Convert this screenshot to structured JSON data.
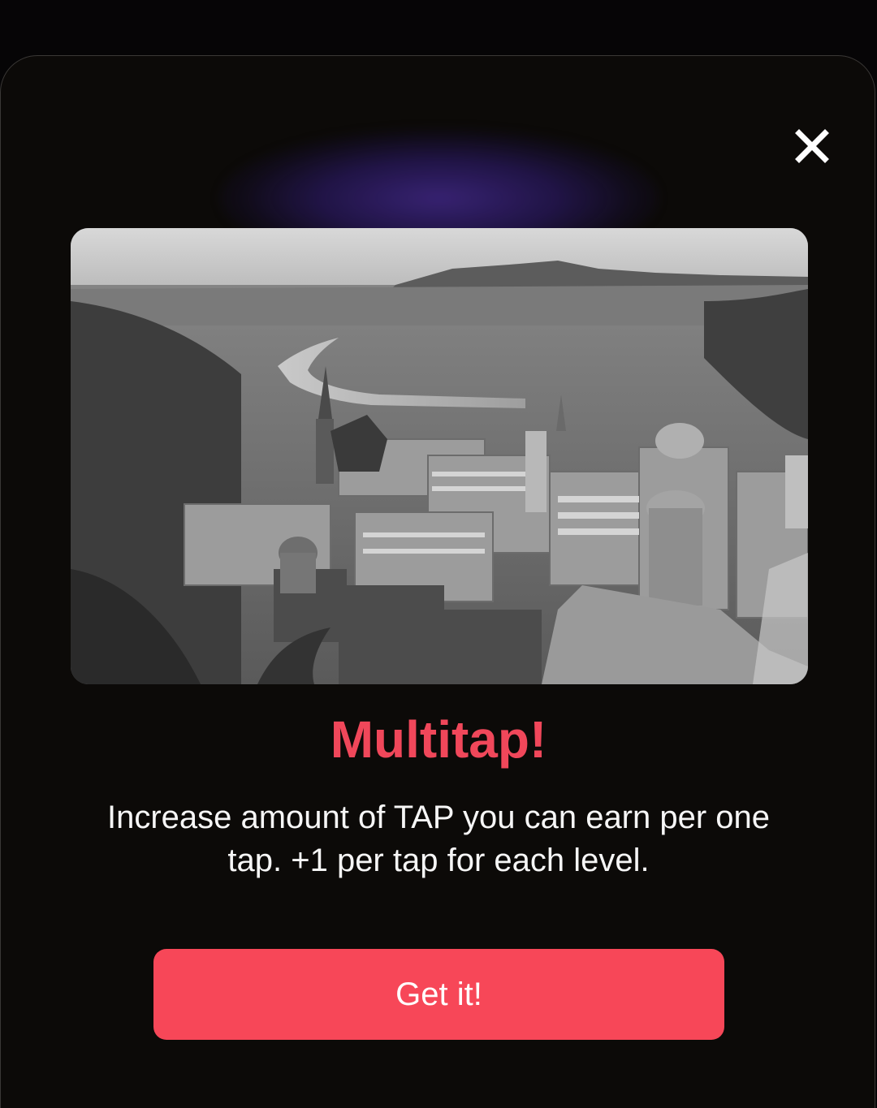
{
  "modal": {
    "close_icon": "close-icon",
    "image_icon": "city-photo",
    "title": "Multitap!",
    "description": "Increase amount of TAP you can earn per one tap. +1 per tap for each level.",
    "button_label": "Get it!"
  },
  "colors": {
    "page_background": "#060506",
    "sheet_background": "#0c0a08",
    "title": "#f0475a",
    "button": "#f74758",
    "glow": "#3a2478"
  }
}
